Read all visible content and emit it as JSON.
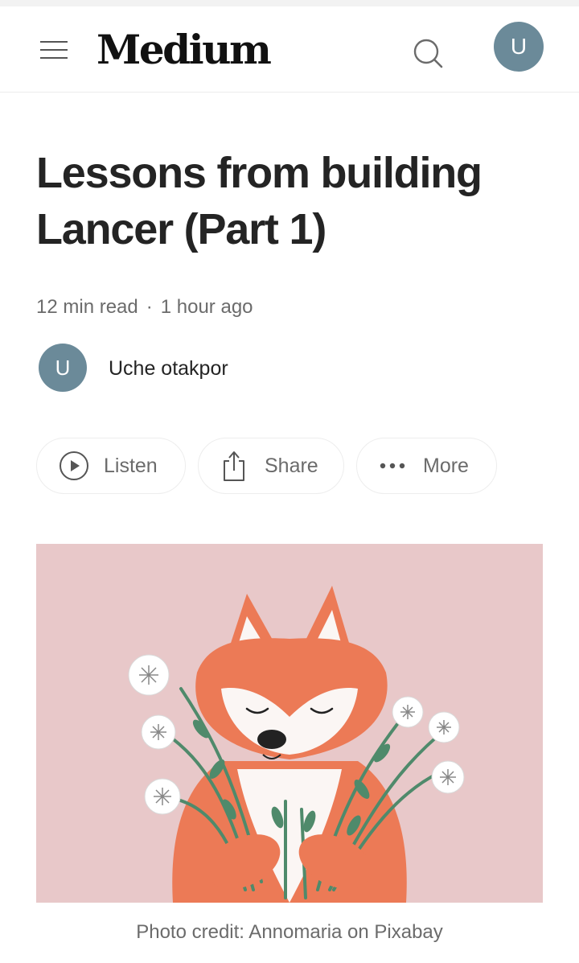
{
  "header": {
    "logo": "Medium",
    "avatar_initial": "U"
  },
  "article": {
    "title": "Lessons from building Lancer (Part 1)",
    "read_time": "12 min read",
    "separator": "·",
    "posted": "1 hour ago",
    "author": {
      "initial": "U",
      "name": "Uche otakpor"
    }
  },
  "actions": {
    "listen_label": "Listen",
    "share_label": "Share",
    "more_label": "More"
  },
  "image": {
    "caption": "Photo credit: Annomaria on Pixabay"
  },
  "colors": {
    "avatar_bg": "#6b8a99",
    "image_bg": "#e8c8c9",
    "fox": "#ec7a56",
    "leaves": "#4f8a6b"
  }
}
